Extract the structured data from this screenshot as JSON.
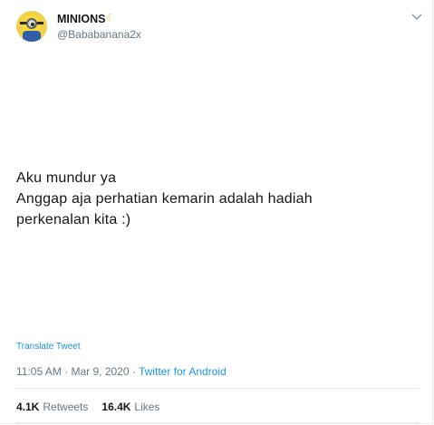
{
  "author": {
    "display_name": "MINIONS",
    "handle": "@Bababanana2x",
    "badge_icon": "crescent-moon-icon"
  },
  "tweet": {
    "lines": [
      "Aku mundur ya",
      "Anggap aja perhatian kemarin adalah hadiah",
      "perkenalan kita :)"
    ],
    "translate_label": "Translate Tweet",
    "time": "11:05 AM",
    "separator1": " · ",
    "date": "Mar 9, 2020",
    "separator2": " · ",
    "source": "Twitter for Android"
  },
  "stats": {
    "retweets_count": "4.1K",
    "retweets_label": "Retweets",
    "likes_count": "16.4K",
    "likes_label": "Likes"
  },
  "colors": {
    "link": "#1b95e0",
    "secondary_text": "#657786",
    "primary_text": "#14171a",
    "divider": "#e6ecf0"
  }
}
